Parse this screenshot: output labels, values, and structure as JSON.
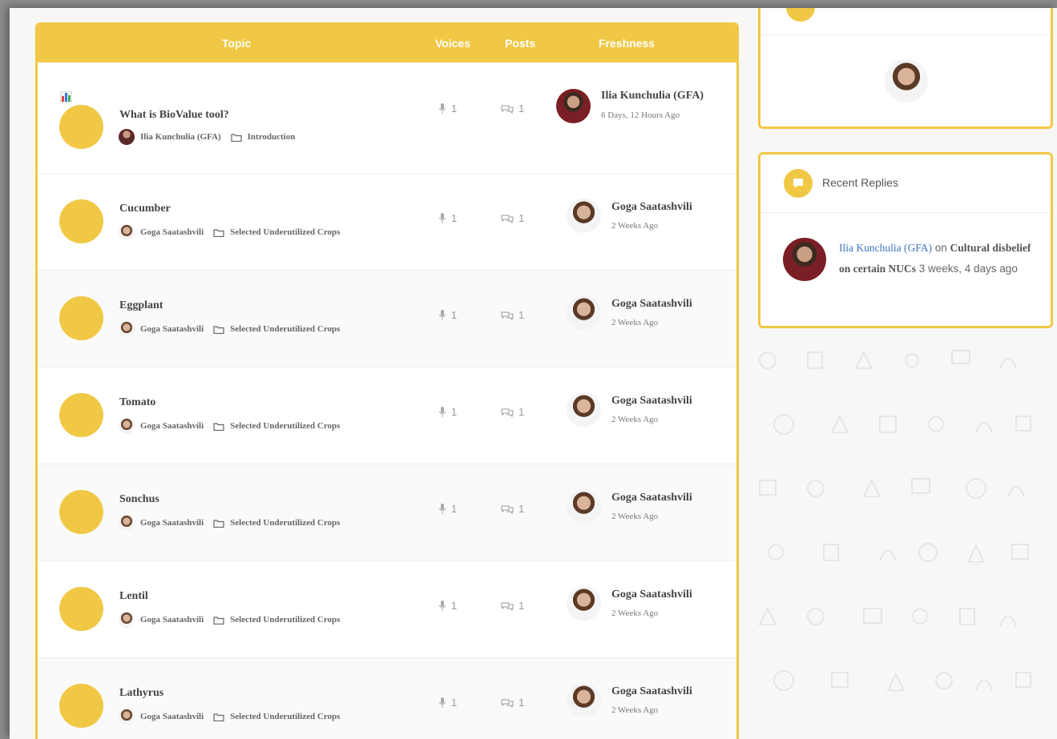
{
  "header": {
    "topic": "Topic",
    "voices": "Voices",
    "posts": "Posts",
    "freshness": "Freshness"
  },
  "topics": [
    {
      "title": "What is BioValue tool?",
      "author": "Ilia Kunchulia (GFA)",
      "forum": "Introduction",
      "voices": "1",
      "posts": "1",
      "fresh_author": "Ilia Kunchulia (GFA)",
      "fresh_time": "6 Days, 12 Hours Ago"
    },
    {
      "title": "Cucumber",
      "author": "Goga Saatashvili",
      "forum": "Selected Underutilized Crops",
      "voices": "1",
      "posts": "1",
      "fresh_author": "Goga Saatashvili",
      "fresh_time": "2 Weeks Ago"
    },
    {
      "title": "Eggplant",
      "author": "Goga Saatashvili",
      "forum": "Selected Underutilized Crops",
      "voices": "1",
      "posts": "1",
      "fresh_author": "Goga Saatashvili",
      "fresh_time": "2 Weeks Ago"
    },
    {
      "title": "Tomato",
      "author": "Goga Saatashvili",
      "forum": "Selected Underutilized Crops",
      "voices": "1",
      "posts": "1",
      "fresh_author": "Goga Saatashvili",
      "fresh_time": "2 Weeks Ago"
    },
    {
      "title": "Sonchus",
      "author": "Goga Saatashvili",
      "forum": "Selected Underutilized Crops",
      "voices": "1",
      "posts": "1",
      "fresh_author": "Goga Saatashvili",
      "fresh_time": "2 Weeks Ago"
    },
    {
      "title": "Lentil",
      "author": "Goga Saatashvili",
      "forum": "Selected Underutilized Crops",
      "voices": "1",
      "posts": "1",
      "fresh_author": "Goga Saatashvili",
      "fresh_time": "2 Weeks Ago"
    },
    {
      "title": "Lathyrus",
      "author": "Goga Saatashvili",
      "forum": "Selected Underutilized Crops",
      "voices": "1",
      "posts": "1",
      "fresh_author": "Goga Saatashvili",
      "fresh_time": "2 Weeks Ago"
    }
  ],
  "recent_replies": {
    "title": "Recent Replies",
    "user": "Ilia Kunchulia (GFA)",
    "connector": " on ",
    "topic": "Cultural disbelief on certain NUCs",
    "time": " 3 weeks, 4 days ago"
  },
  "colors": {
    "accent": "#f0c845",
    "link": "#3c74c2"
  },
  "icons": {
    "voices": "microphone-icon",
    "posts": "chat-bubbles-icon",
    "forum": "folder-icon",
    "reply": "comment-icon",
    "topic_type": "bar-chart-icon"
  }
}
